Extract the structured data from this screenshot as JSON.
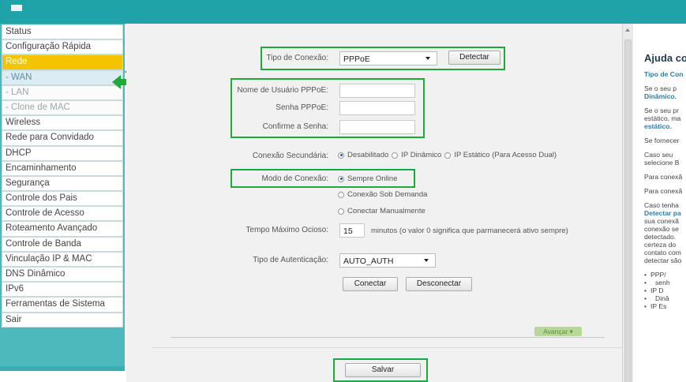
{
  "sidebar": {
    "items": [
      {
        "label": "Status"
      },
      {
        "label": "Configuração Rápida"
      },
      {
        "label": "Rede"
      },
      {
        "label": "- WAN"
      },
      {
        "label": "- LAN"
      },
      {
        "label": "- Clone de MAC"
      },
      {
        "label": "Wireless"
      },
      {
        "label": "Rede para Convidado"
      },
      {
        "label": "DHCP"
      },
      {
        "label": "Encaminhamento"
      },
      {
        "label": "Segurança"
      },
      {
        "label": "Controle dos Pais"
      },
      {
        "label": "Controle de Acesso"
      },
      {
        "label": "Roteamento Avançado"
      },
      {
        "label": "Controle de Banda"
      },
      {
        "label": "Vinculação IP & MAC"
      },
      {
        "label": "DNS Dinâmico"
      },
      {
        "label": "IPv6"
      },
      {
        "label": "Ferramentas de Sistema"
      },
      {
        "label": "Sair"
      }
    ]
  },
  "form": {
    "connection_type_label": "Tipo de Conexão:",
    "connection_type_value": "PPPoE",
    "detect_button": "Detectar",
    "username_label": "Nome de Usuário PPPoE:",
    "password_label": "Senha PPPoE:",
    "confirm_label": "Confirme a Senha:",
    "secondary_label": "Conexão Secundária:",
    "secondary_options": [
      "Desabilitado",
      "IP Dinâmico",
      "IP Estático (Para Acesso Dual)"
    ],
    "mode_label": "Modo de Conexão:",
    "mode_options": [
      "Sempre Online",
      "Conexão Sob Demanda",
      "Conectar Manualmente"
    ],
    "idle_label": "Tempo Máximo Ocioso:",
    "idle_value": "15",
    "idle_hint": "minutos (o valor 0 significa que parmanecerá ativo sempre)",
    "auth_label": "Tipo de Autenticação:",
    "auth_value": "AUTO_AUTH",
    "connect_button": "Conectar",
    "disconnect_button": "Desconectar",
    "advanced_button": "Avançar",
    "save_button": "Salvar"
  },
  "help": {
    "title": "Ajuda co",
    "lines": [
      "Tipo de Con",
      "Se o seu p",
      "Dinâmico.",
      "Se o seu pr",
      "estático, ma",
      "estático.",
      "Se fornecer",
      "Caso seu",
      "selecione B",
      "Para conexã",
      "Para conexã",
      "Caso tenha",
      "Detectar pa",
      "sua conexã",
      "conexão se",
      "detectado.",
      "certeza do",
      "contato com",
      "detectar são",
      "PPP/",
      "senh",
      "IP D",
      "Dinâ",
      "IP Es"
    ]
  },
  "colors": {
    "header": "#1fa3a8",
    "sidebar": "#4db9bd",
    "active_item": "#f5c400",
    "highlight": "#1daa3a"
  }
}
